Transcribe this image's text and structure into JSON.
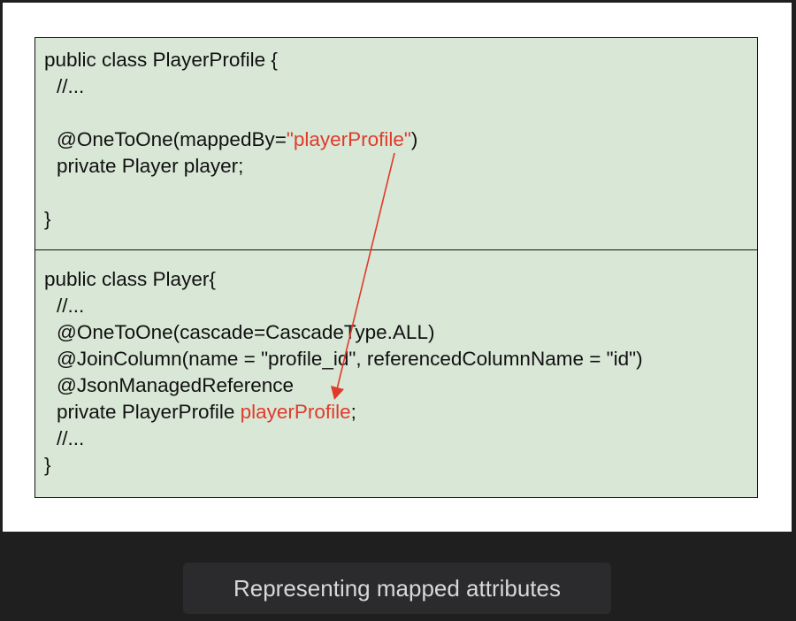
{
  "diagram": {
    "top_box": {
      "line1": "public class PlayerProfile {",
      "line2": "//...",
      "line3_prefix": "@OneToOne(mappedBy=",
      "line3_highlight": "\"playerProfile\"",
      "line3_suffix": ")",
      "line4": "private Player player;",
      "line5": "}"
    },
    "bottom_box": {
      "line1": "public class Player{",
      "line2": "//...",
      "line3": "@OneToOne(cascade=CascadeType.ALL)",
      "line4": "@JoinColumn(name = \"profile_id\", referencedColumnName = \"id\")",
      "line5": "@JsonManagedReference",
      "line6_prefix": "private PlayerProfile ",
      "line6_highlight": "playerProfile",
      "line6_suffix": ";",
      "line7": "//...",
      "line8": "}"
    },
    "highlight_color": "#e03a2b",
    "box_fill": "#d9e7d6"
  },
  "caption": "Representing mapped attributes"
}
